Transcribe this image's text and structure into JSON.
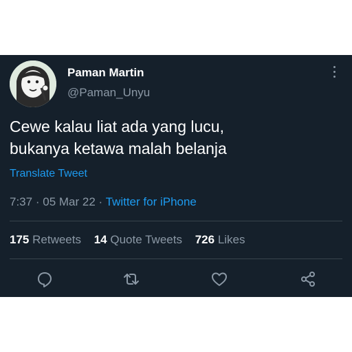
{
  "user": {
    "display_name": "Paman Martin",
    "handle": "@Paman_Unyu",
    "avatar_icon": "cartoon-avatar"
  },
  "tweet": {
    "line1": "Cewe kalau liat ada yang lucu,",
    "line2": "bukanya ketawa malah belanja",
    "translate_label": "Translate Tweet"
  },
  "meta": {
    "time": "7:37",
    "date": "05 Mar 22",
    "separator": "·",
    "source": "Twitter for iPhone"
  },
  "stats": {
    "retweets_count": "175",
    "retweets_label": "Retweets",
    "quotes_count": "14",
    "quotes_label": "Quote Tweets",
    "likes_count": "726",
    "likes_label": "Likes"
  },
  "actions": [
    "reply-icon",
    "retweet-icon",
    "like-icon",
    "share-icon"
  ],
  "colors": {
    "background": "#15202b",
    "text": "#ffffff",
    "secondary": "#8b98a5",
    "accent": "#1d9bf0",
    "divider": "#38444d"
  }
}
